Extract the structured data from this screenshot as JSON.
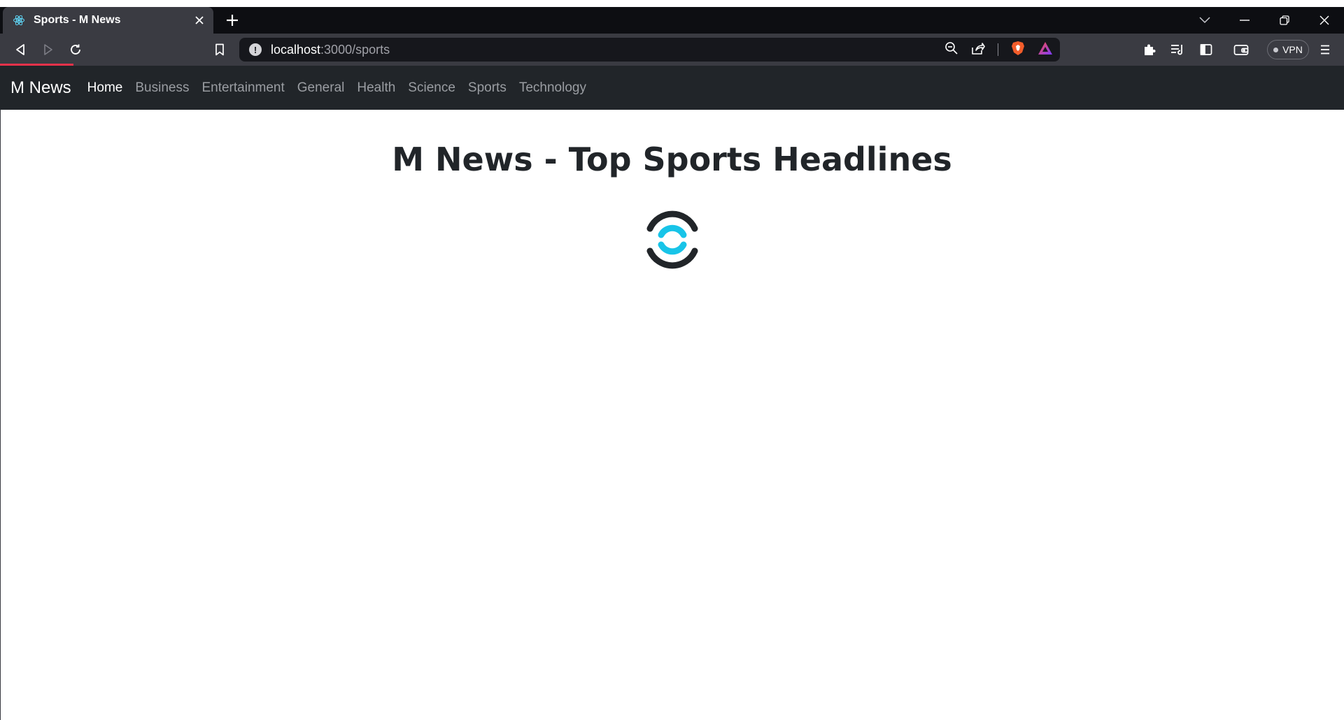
{
  "browser": {
    "tab": {
      "title": "Sports - M News",
      "favicon": "react-atom-icon"
    },
    "url": {
      "host": "localhost",
      "rest": ":3000/sports"
    },
    "vpn_label": "VPN",
    "colors": {
      "frame": "#0d0e12",
      "toolbar": "#3a3b42",
      "urlbar": "#16171c",
      "progress": "#e8324a"
    }
  },
  "navbar": {
    "brand": "M News",
    "links": [
      {
        "label": "Home",
        "active": true
      },
      {
        "label": "Business",
        "active": false
      },
      {
        "label": "Entertainment",
        "active": false
      },
      {
        "label": "General",
        "active": false
      },
      {
        "label": "Health",
        "active": false
      },
      {
        "label": "Science",
        "active": false
      },
      {
        "label": "Sports",
        "active": false
      },
      {
        "label": "Technology",
        "active": false
      }
    ],
    "colors": {
      "background": "#212529",
      "active": "#ffffff",
      "inactive": "#9a9da2"
    }
  },
  "main": {
    "heading": "M News - Top Sports Headlines",
    "spinner": {
      "icon": "loading-spinner-icon",
      "colors": [
        "#212529",
        "#18c4e8"
      ]
    }
  }
}
